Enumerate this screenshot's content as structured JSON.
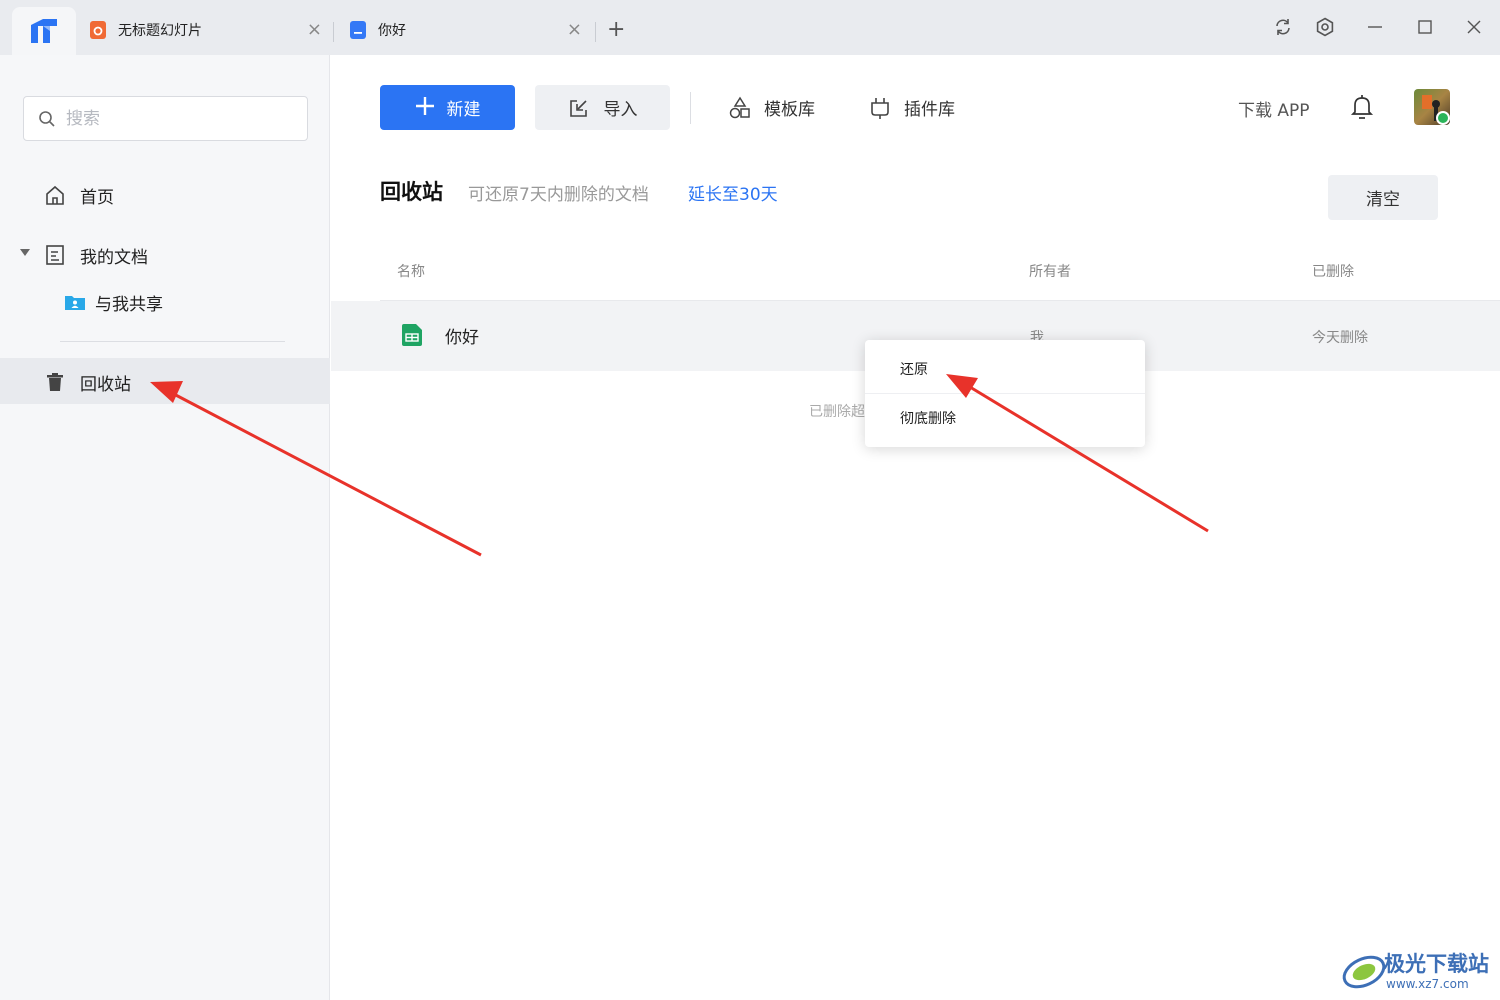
{
  "tabs": [
    {
      "label": "无标题幻灯片",
      "color": "#f06a35"
    },
    {
      "label": "你好",
      "color": "#3478f6"
    }
  ],
  "tab_close": "×",
  "new_tab": "+",
  "search": {
    "placeholder": "搜索"
  },
  "sidebar": {
    "items": [
      {
        "label": "首页",
        "icon": "home-icon"
      },
      {
        "label": "我的文档",
        "icon": "document-icon"
      },
      {
        "label": "与我共享",
        "icon": "shared-folder-icon"
      },
      {
        "label": "回收站",
        "icon": "trash-icon"
      }
    ]
  },
  "toolbar": {
    "new_label": "新建",
    "import_label": "导入",
    "templates_label": "模板库",
    "plugins_label": "插件库",
    "download_label": "下载 APP"
  },
  "page": {
    "title": "回收站",
    "description": "可还原7天内删除的文档",
    "extend_link": "延长至30天",
    "clear_label": "清空"
  },
  "table": {
    "headers": [
      "名称",
      "所有者",
      "已删除"
    ],
    "rows": [
      {
        "name": "你好",
        "owner": "我",
        "deleted": "今天删除"
      }
    ],
    "hint": "已删除超"
  },
  "context_menu": {
    "items": [
      "还原",
      "彻底删除"
    ]
  },
  "watermark": {
    "text": "极光下载站",
    "url": "www.xz7.com"
  },
  "colors": {
    "accent": "#2b74f3",
    "annotation": "#e8322a",
    "sheet_green": "#1fa463"
  }
}
